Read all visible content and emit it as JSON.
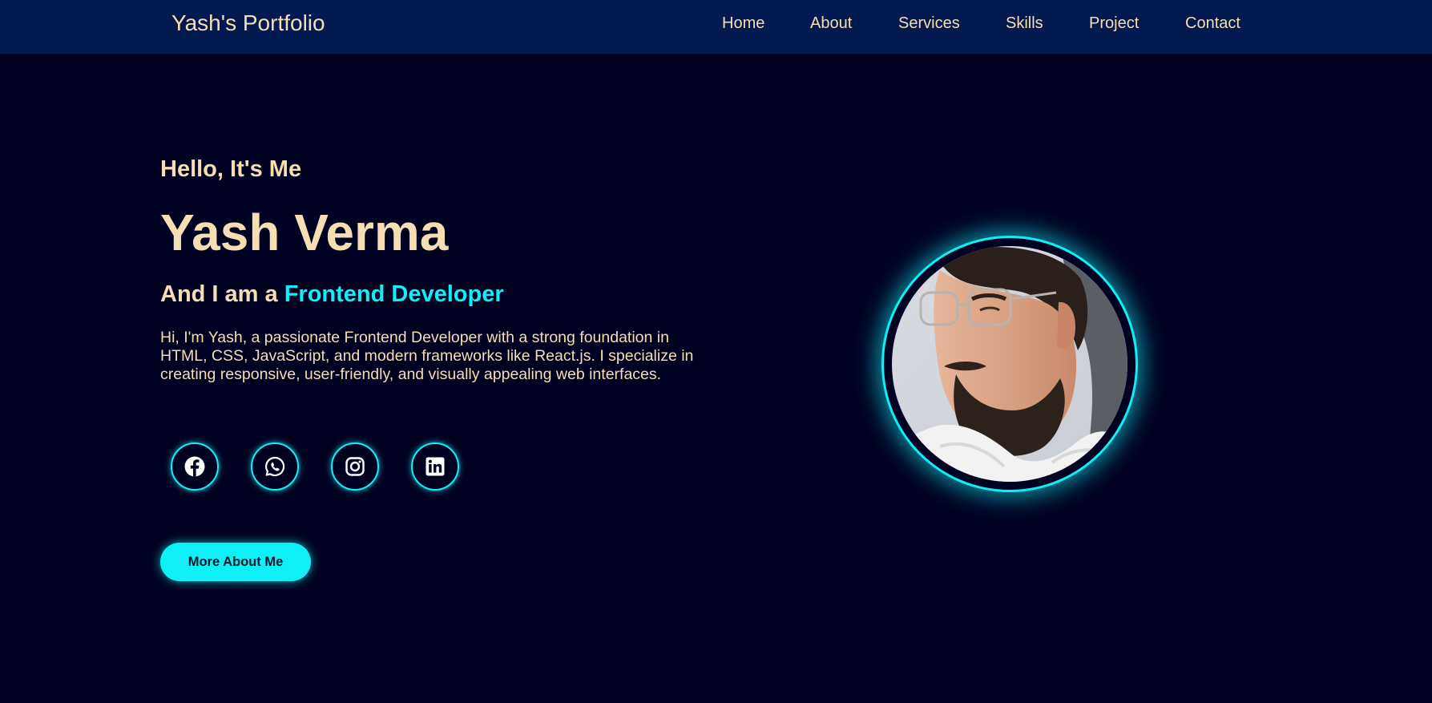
{
  "navbar": {
    "logo": "Yash's Portfolio",
    "links": [
      {
        "label": "Home"
      },
      {
        "label": "About"
      },
      {
        "label": "Services"
      },
      {
        "label": "Skills"
      },
      {
        "label": "Project"
      },
      {
        "label": "Contact"
      }
    ]
  },
  "hero": {
    "greeting": "Hello, It's Me",
    "name": "Yash Verma",
    "role_prefix": "And I am a",
    "role_highlight": "Frontend Developer",
    "description": "Hi, I'm Yash, a passionate Frontend Developer with a strong foundation in HTML, CSS, JavaScript, and modern frameworks like React.js. I specialize in creating responsive, user-friendly, and visually appealing web interfaces.",
    "cta_label": "More About Me"
  },
  "social": [
    {
      "icon": "facebook-icon"
    },
    {
      "icon": "whatsapp-icon"
    },
    {
      "icon": "instagram-icon"
    },
    {
      "icon": "linkedin-icon"
    }
  ],
  "avatar": {
    "icon": "profile-photo"
  },
  "colors": {
    "background": "#000021",
    "navbar": "#021a4f",
    "text": "#f5deb3",
    "accent": "#0ef0f5"
  }
}
